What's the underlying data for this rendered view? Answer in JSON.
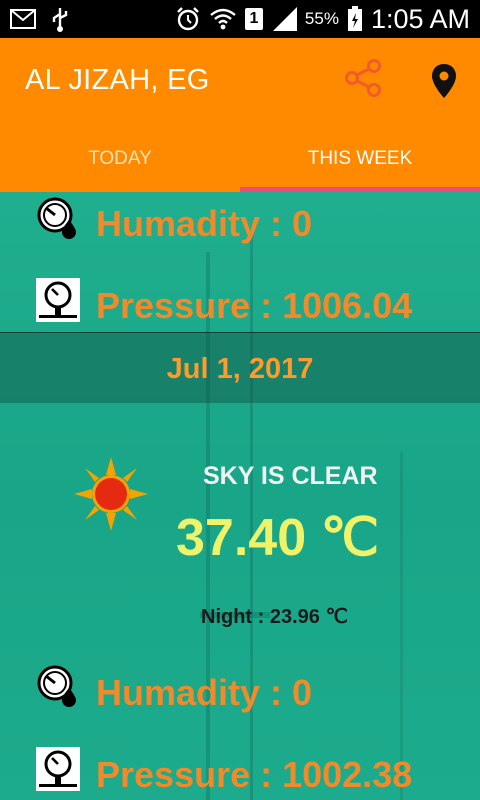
{
  "status_bar": {
    "time": "1:05 AM",
    "battery": "55%",
    "sim": "1",
    "icons": [
      "mail-icon",
      "usb-icon",
      "alarm-icon",
      "wifi-icon",
      "sim-icon",
      "signal-icon",
      "battery-icon"
    ]
  },
  "header": {
    "location": "AL JIZAH, EG",
    "actions": [
      "share-icon",
      "location-pin-icon"
    ]
  },
  "tabs": [
    {
      "label": "TODAY",
      "active": false
    },
    {
      "label": "THIS WEEK",
      "active": true
    }
  ],
  "day_prev": {
    "humidity": "Humadity : 0",
    "pressure": "Pressure : 1006.04"
  },
  "day": {
    "date": "Jul 1, 2017",
    "condition": "SKY IS CLEAR",
    "temperature": "37.40 ℃",
    "night": "Night : 23.96 ℃",
    "humidity": "Humadity : 0",
    "pressure": "Pressure : 1002.38",
    "icon": "sun-icon"
  },
  "colors": {
    "appbar": "#ff8a00",
    "content": "#1ba88a",
    "tab_indicator": "#e94d7c",
    "stat_text": "#f08a2a",
    "temperature": "#eef36a"
  }
}
